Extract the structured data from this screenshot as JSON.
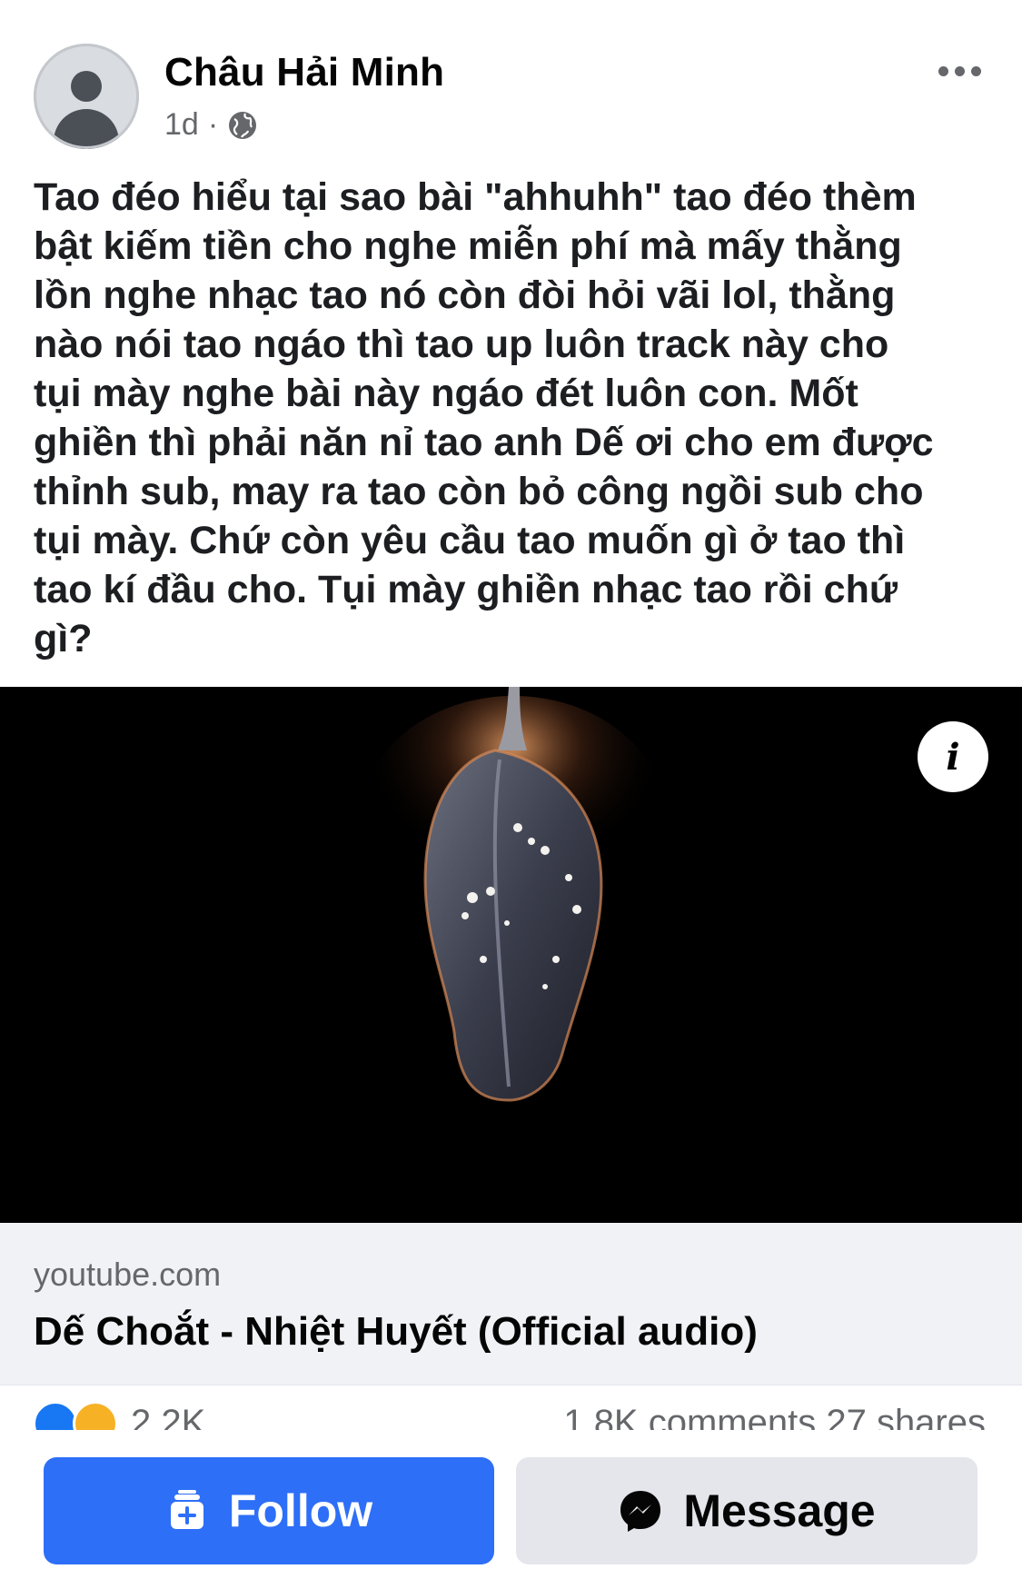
{
  "post": {
    "author": "Châu Hải Minh",
    "time": "1d",
    "dot": "·",
    "privacy_icon": "globe-icon",
    "text": "Tao đéo hiểu tại sao bài \"ahhuhh\" tao đéo thèm\nbật kiếm tiền cho nghe miễn phí mà mấy thằng\nlồn nghe nhạc tao nó còn đòi hỏi vãi lol, thằng\nnào nói tao ngáo thì tao up luôn track này cho\ntụi mày nghe bài này ngáo đét luôn con. Mốt\nghiền thì phải năn nỉ tao anh Dế ơi cho em được\nthỉnh sub, may ra tao còn bỏ công ngồi sub cho\ntụi mày. Chứ còn yêu cầu tao muốn gì ở tao thì\ntao kí đầu cho. Tụi mày ghiền nhạc tao rồi chứ\ngì?"
  },
  "link_preview": {
    "info_icon": "info-icon",
    "info_label": "i",
    "domain": "youtube.com",
    "title": "Dế Choắt - Nhiệt Huyết (Official audio)"
  },
  "stats": {
    "reaction_count": "2.2K",
    "comments_shares": "1.8K comments  27 shares"
  },
  "actions": {
    "follow_label": "Follow",
    "message_label": "Message"
  },
  "colors": {
    "follow_bg": "#2d6ff7",
    "message_bg": "#e4e6eb",
    "secondary_text": "#65676b"
  }
}
